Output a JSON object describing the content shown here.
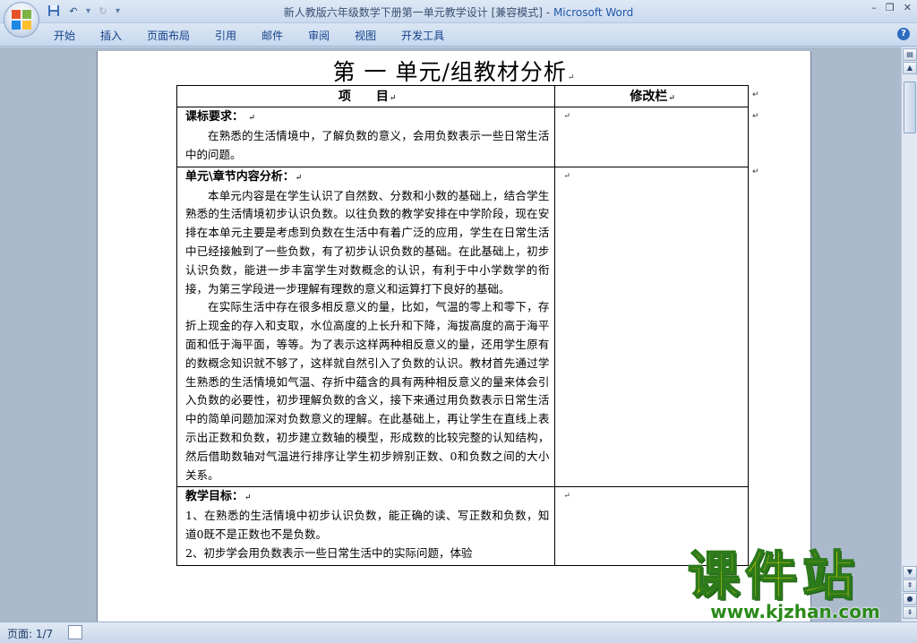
{
  "window": {
    "title": "新人教版六年级数学下册第一单元教学设计 [兼容模式]",
    "app_name": "Microsoft Word",
    "separator": " - "
  },
  "ribbon": {
    "tabs": [
      "开始",
      "插入",
      "页面布局",
      "引用",
      "邮件",
      "审阅",
      "视图",
      "开发工具"
    ]
  },
  "document": {
    "heading": "第 一 单元/组教材分析",
    "table": {
      "col_header_item": "项　　目",
      "col_header_revision": "修改栏",
      "sections": [
        {
          "label": "课标要求：",
          "paragraphs": [
            "在熟悉的生活情境中，了解负数的意义，会用负数表示一些日常生活中的问题。"
          ]
        },
        {
          "label": "单元\\章节内容分析：",
          "paragraphs": [
            "本单元内容是在学生认识了自然数、分数和小数的基础上，结合学生熟悉的生活情境初步认识负数。以往负数的教学安排在中学阶段，现在安排在本单元主要是考虑到负数在生活中有着广泛的应用，学生在日常生活中已经接触到了一些负数，有了初步认识负数的基础。在此基础上，初步认识负数，能进一步丰富学生对数概念的认识，有利于中小学数学的衔接，为第三学段进一步理解有理数的意义和运算打下良好的基础。",
            "在实际生活中存在很多相反意义的量，比如，气温的零上和零下，存折上现金的存入和支取，水位高度的上长升和下降，海拔高度的高于海平面和低于海平面，等等。为了表示这样两种相反意义的量，还用学生原有的数概念知识就不够了，这样就自然引入了负数的认识。教材首先通过学生熟悉的生活情境如气温、存折中蕴含的具有两种相反意义的量来体会引入负数的必要性，初步理解负数的含义，接下来通过用负数表示日常生活中的简单问题加深对负数意义的理解。在此基础上，再让学生在直线上表示出正数和负数，初步建立数轴的模型，形成数的比较完整的认知结构，然后借助数轴对气温进行排序让学生初步辨别正数、0和负数之间的大小关系。"
          ]
        },
        {
          "label": "教学目标：",
          "paragraphs": [
            "1、在熟悉的生活情境中初步认识负数，能正确的读、写正数和负数，知道0既不是正数也不是负数。",
            "2、初步学会用负数表示一些日常生活中的实际问题，体验"
          ]
        }
      ]
    }
  },
  "status_bar": {
    "page_info": "页面: 1/7"
  },
  "watermark": {
    "main": "课件站",
    "url": "www.kjzhan.com"
  },
  "colors": {
    "app_name": "#1f56a8",
    "watermark_fill": "#f4e100",
    "watermark_stroke": "#2c7a1b"
  }
}
